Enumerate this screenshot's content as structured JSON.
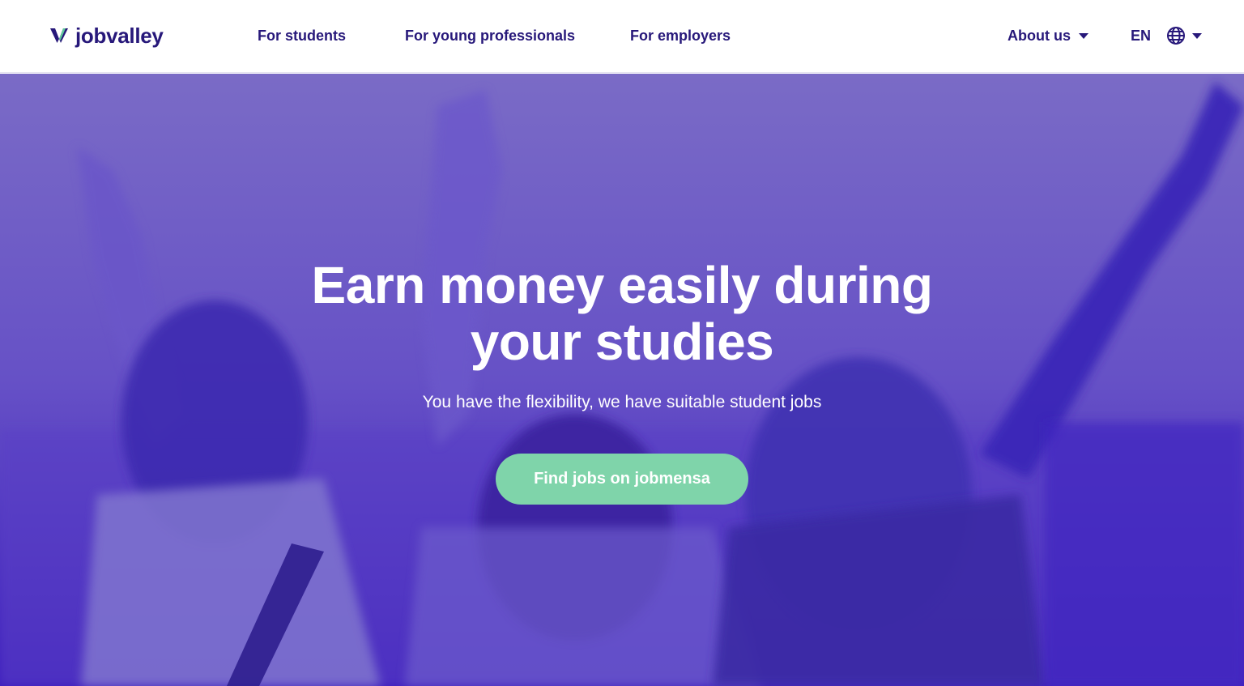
{
  "header": {
    "logo": {
      "text": "jobvalley",
      "mark_icon": "v-logo-icon",
      "mark_colors": [
        "#27187a",
        "#5fc99b"
      ]
    },
    "nav": [
      {
        "label": "For students"
      },
      {
        "label": "For young professionals"
      },
      {
        "label": "For employers"
      }
    ],
    "about": {
      "label": "About us",
      "icon": "chevron-down-icon"
    },
    "language": {
      "code": "EN",
      "icon": "globe-icon",
      "dropdown_icon": "chevron-down-icon"
    }
  },
  "hero": {
    "title_line1": "Earn money easily during",
    "title_line2": "your studies",
    "subtitle": "You have the flexibility, we have suitable student jobs",
    "cta_label": "Find jobs on jobmensa"
  },
  "colors": {
    "brand_purple": "#27187a",
    "hero_overlay": "#4f34c4",
    "cta_green": "#7fd4aa",
    "text_on_hero": "#ffffff"
  }
}
